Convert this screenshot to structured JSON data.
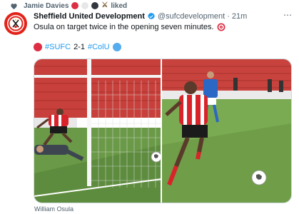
{
  "social_context": {
    "user": "Jamie Davies",
    "action": "liked"
  },
  "tweet": {
    "display_name": "Sheffield United Development",
    "handle": "@sufcdevelopment",
    "separator": "·",
    "time": "21m",
    "text": "Osula on target twice in the opening seven minutes.",
    "hashtag_home": "#SUFC",
    "score": "2-1",
    "hashtag_away": "#ColU",
    "media_caption": "William Osula"
  },
  "icons": {
    "heart": "heart-icon",
    "verified": "verified-badge-icon",
    "target": "direct-hit-emoji",
    "more": "more-options-icon",
    "swords": "crossed-swords-emoji"
  },
  "colors": {
    "link": "#1d9bf0",
    "verified": "#1d9bf0",
    "club_red": "#e2231a",
    "secondary_text": "#536471",
    "colu_blue": "#4a9fe8"
  }
}
